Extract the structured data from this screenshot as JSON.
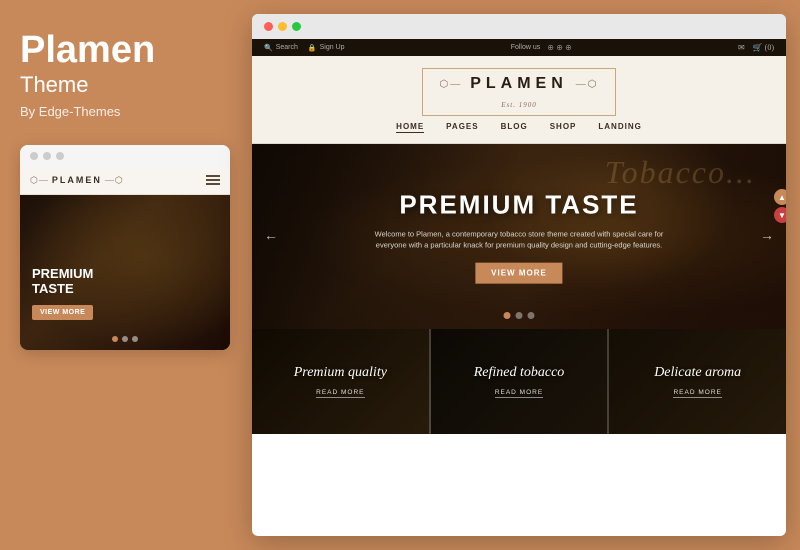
{
  "left": {
    "title": "Plamen",
    "subtitle": "Theme",
    "by": "By Edge-Themes",
    "mobile_card": {
      "logo_deco": "⬡—P—⬡",
      "logo_text": "PLAMEN",
      "hero_title_line1": "PREMIUM",
      "hero_title_line2": "TASTE",
      "hero_btn": "VIEW MORE",
      "dots": [
        "active",
        "inactive",
        "inactive"
      ]
    }
  },
  "browser": {
    "topbar_left": [
      "Search",
      "Sign Up"
    ],
    "topbar_center": "Follow us",
    "topbar_right_icons": [
      "envelope",
      "cart"
    ],
    "logo_deco_left": "⬡—",
    "logo_text": "PLAMEN",
    "logo_deco_right": "—⬡",
    "logo_sub": "Est. 1900",
    "nav_items": [
      "HOME",
      "PAGES",
      "BLOG",
      "SHOP",
      "LANDING"
    ],
    "nav_active": "HOME",
    "hero_script": "Tobacco",
    "hero_title": "PREMIUM TASTE",
    "hero_desc": "Welcome to Plamen, a contemporary tobacco store theme created with special care for everyone with a particular knack for premium quality design and cutting-edge features.",
    "hero_btn": "VIEW MORE",
    "hero_dots": [
      "active",
      "inactive",
      "inactive"
    ],
    "cards": [
      {
        "title": "Premium quality",
        "read_more": "READ MORE"
      },
      {
        "title": "Refined tobacco",
        "read_more": "READ MORE"
      },
      {
        "title": "Delicate aroma",
        "read_more": "READ MORE"
      }
    ]
  },
  "colors": {
    "accent": "#c8895a",
    "dark_bg": "#1a1005",
    "panel_bg": "#c8895a"
  }
}
